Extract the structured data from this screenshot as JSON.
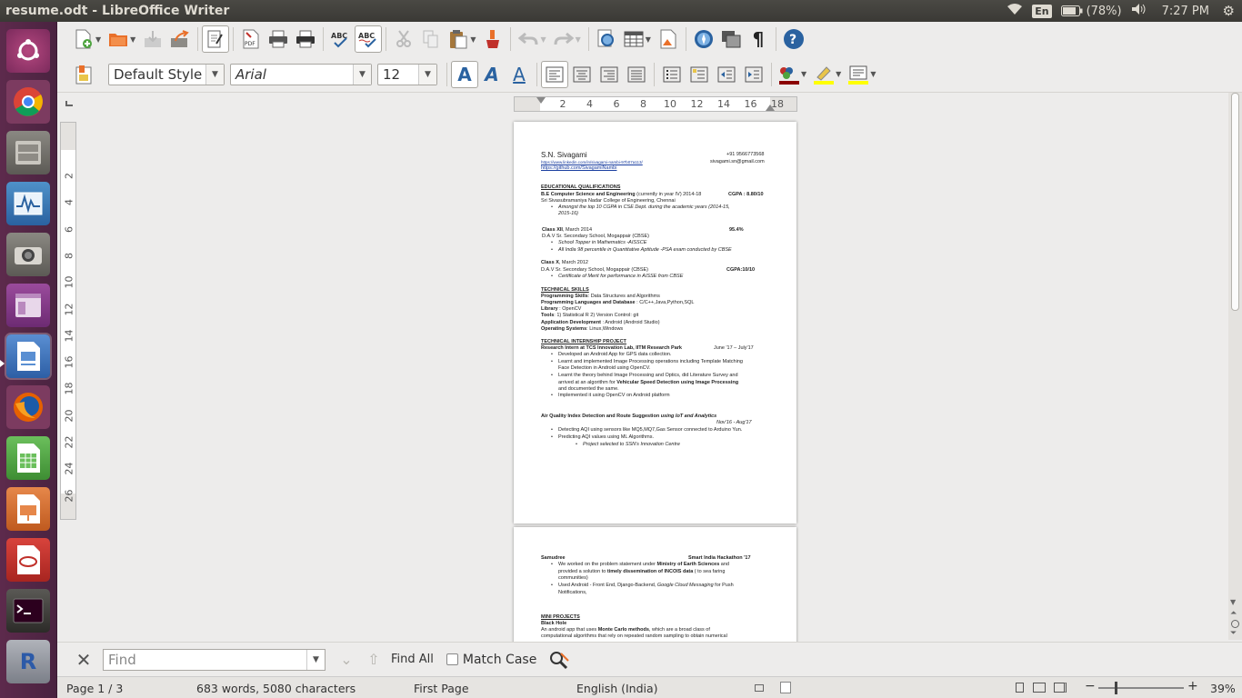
{
  "window": {
    "title": "resume.odt - LibreOffice Writer"
  },
  "tray": {
    "keyboard": "En",
    "battery": "(78%)",
    "time": "7:27 PM"
  },
  "launcher": {
    "items": [
      "Ubuntu Dash",
      "Chrome",
      "Files",
      "System Monitor",
      "Camera",
      "Files",
      "LibreOffice Writer",
      "Firefox",
      "LibreOffice Calc",
      "LibreOffice Impress",
      "App",
      "Terminal",
      "R"
    ]
  },
  "formatting": {
    "style": "Default Style",
    "font": "Arial",
    "size": "12"
  },
  "ruler": {
    "h_ticks": [
      "2",
      "4",
      "6",
      "8",
      "10",
      "12",
      "14",
      "16",
      "18"
    ],
    "v_ticks": [
      "2",
      "4",
      "6",
      "8",
      "10",
      "12",
      "14",
      "16",
      "18",
      "20",
      "22",
      "24",
      "26"
    ]
  },
  "find": {
    "placeholder": "Find",
    "find_all": "Find All",
    "match_case": "Match Case"
  },
  "status": {
    "page": "Page 1 / 3",
    "words": "683 words, 5080 characters",
    "page_style": "First Page",
    "language": "English (India)",
    "zoom": "39%",
    "zoom_level": 0.39
  },
  "doc": {
    "name": "S.N. Sivagami",
    "phone": "+91 9566773568",
    "linkedin": "https://www.linkedin.com/in/sivagami-nambi-97b07a113/",
    "email": "sivagami.sn@gmail.com",
    "github": "https://github.com/SivagamiNambi",
    "h_edu": "EDUCATIONAL QUALIFICATIONS",
    "edu1_title": "B.E Computer Science and Engineering",
    "edu1_mid": " (currently in year IV) 2014-18",
    "edu1_cgpa": "CGPA : 8.80/10",
    "edu1_school": "Sri Sivasubramaniya Nadar College of Engineering, Chennai",
    "edu1_b1": "Amongst the top 10 CGPA in CSE Dept. during the academic years (2014-15,",
    "edu1_b1b": "2015-16)",
    "edu2_title": "Class XII",
    "edu2_date": ", March 2014",
    "edu2_score": "95.4%",
    "edu2_school": "D.A.V Sr. Secondary School, Mogappair (CBSE)",
    "edu2_b1": "School Topper in Mathematics -AISSCE",
    "edu2_b2": "All India 98 percentile in Quantitative Aptitude -PSA exam conducted by CBSE",
    "edu3_title": "Class X",
    "edu3_date": ", March 2012",
    "edu3_school": "D.A.V Sr. Secondary School, Mogappair (CBSE)",
    "edu3_score": "CGPA:10/10",
    "edu3_b1": "Certificate of Merit for performance in AISSE from CBSE",
    "h_tech": "TECHNICAL SKILLS",
    "sk1_k": "Programming Skills",
    "sk1_v": ": Data Structures and Algorithms",
    "sk2_k": "Programming Languages and Database",
    "sk2_v": " : C/C++,Java,Python,SQL",
    "sk3_k": "Library",
    "sk3_v": " : OpenCV",
    "sk4_k": "Tools",
    "sk4_v": ": 1) Statistical R   2) Version Control: git",
    "sk5_k": "Application Development",
    "sk5_v": " : Android (Android Studio)",
    "sk6_k": "Operating Systems",
    "sk6_v": ": Linux,Windows",
    "h_intern": "TECHNICAL INTERNSHIP PROJECT",
    "in_title": "Research Intern at TCS Innovation Lab, IITM Research Park",
    "in_date": "June '17 – July'17",
    "in_b1": "Developed an Android App for GPS data collection.",
    "in_b2": "Learnt and implemented Image Processing operations including Template Matching",
    "in_b2b": "Face Detection in Android using OpenCV.",
    "in_b3": "Learnt the theory behind Image Processing and Optics, did Literature Survey and",
    "in_b3b_pre": "arrived at an algorithm for ",
    "in_b3b_bold": "Vehicular Speed Detection using Image Processing",
    "in_b3c": "and documented the same.",
    "in_b4": "Implemented it using OpenCV on Android platform",
    "aq_title": "Air Quality Index Detection and Route Suggestion",
    "aq_title_i": " using IoT and Analytics",
    "aq_date": "Nov'16 - Aug'17",
    "aq_b1": "Detecting AQI using sensors like MQ5,MQ7,Gas Sensor connected to Arduino Yun.",
    "aq_b2": "Predicting AQI values using ML Algorithms.",
    "aq_b3": "Project selected to SSN's Innovation Centre",
    "p2_title": "Samudree",
    "p2_award": "Smart India Hackathon '17",
    "p2_b1_pre": "We worked on the problem statement under ",
    "p2_b1_bold": "Ministry of Earth Sciences",
    "p2_b1_post": " and",
    "p2_b1b_pre": "provided a solution to ",
    "p2_b1b_bold": "timely dissemination of INCOIS data",
    "p2_b1b_post": " ( to sea faring",
    "p2_b1c": "communities)",
    "p2_b2_pre": "Used Android - Front End, Django-Backend, ",
    "p2_b2_i": "Google Cloud Messaging",
    "p2_b2_post": " for Push",
    "p2_b2b": "Notifications,",
    "h_mini": "MINI PROJECTS",
    "mini_title": "Black Hole",
    "mini_l1_pre": "An android app that uses ",
    "mini_l1_bold": "Monte Carlo methods",
    "mini_l1_post": ", which are a broad class of",
    "mini_l2": "computational algorithms that rely on repeated random sampling to obtain numerical"
  }
}
